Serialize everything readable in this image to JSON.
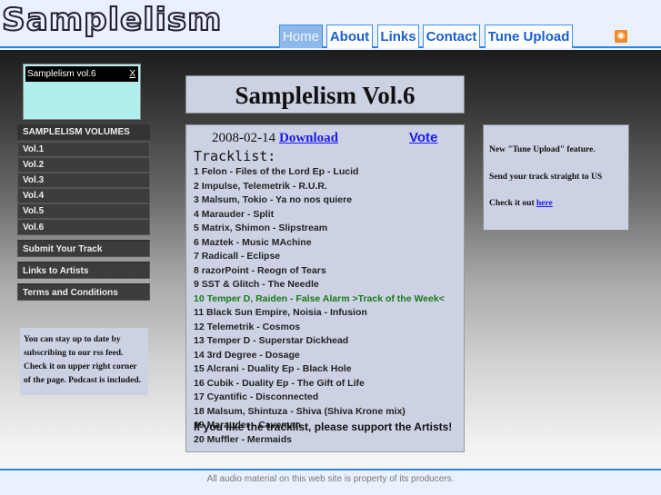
{
  "header": {
    "logo": "Samplelism",
    "nav": [
      "Home",
      "About",
      "Links",
      "Contact",
      "Tune Upload"
    ],
    "active": "Home",
    "rss_icon": "rss-icon"
  },
  "player": {
    "title": "Samplelism vol.6",
    "close": "X"
  },
  "sidebar": {
    "heading": "SAMPLELISM VOLUMES",
    "volumes": [
      "Vol.1",
      "Vol.2",
      "Vol.3",
      "Vol.4",
      "Vol.5",
      "Vol.6"
    ],
    "links": [
      "Submit Your Track",
      "Links to Artists",
      "Terms and Conditions"
    ]
  },
  "info": "You can stay up to date by subscribing to our rss feed. Check it on upper right corner of the page. Podcast is included.",
  "main": {
    "title": "Samplelism Vol.6",
    "date": "2008-02-14",
    "download": "Download",
    "vote": "Vote",
    "tracklist_heading": "Tracklist:",
    "tracks": [
      "1 Felon - Files of the Lord Ep - Lucid",
      "2 Impulse, Telemetrik - R.U.R.",
      "3 Malsum, Tokio - Ya no nos quiere",
      "4 Marauder - Split",
      "5 Matrix, Shimon - Slipstream",
      "6 Maztek - Music MAchine",
      "7 Radicall - Eclipse",
      "8 razorPoint - Reogn of Tears",
      "9 SST & Glitch - The Needle",
      "10 Temper D, Raiden - False Alarm >Track of the Week<",
      "11 Black Sun Empire, Noisia - Infusion",
      "12 Telemetrik - Cosmos",
      "13 Temper D - Superstar Dickhead",
      "14 3rd Degree - Dosage",
      "15 Alcrani - Duality Ep - Black Hole",
      "16 Cubik - Duality Ep - The Gift of Life",
      "17 Cyantific - Disconnected",
      "18 Malsum, Shintuza - Shiva (Shiva Krone mix)",
      "19 Marauder - Caveman",
      "20 Muffler - Mermaids"
    ],
    "highlight_color": "#1a7a1a",
    "support": "If you like the tracklist, please support the Artists!"
  },
  "news": {
    "line1": "New \"Tune Upload\" feature.",
    "line2": "Send your track straight to US",
    "line3": "Check it out",
    "link": "here"
  },
  "footer": "All audio material on this web site is property of its producers."
}
